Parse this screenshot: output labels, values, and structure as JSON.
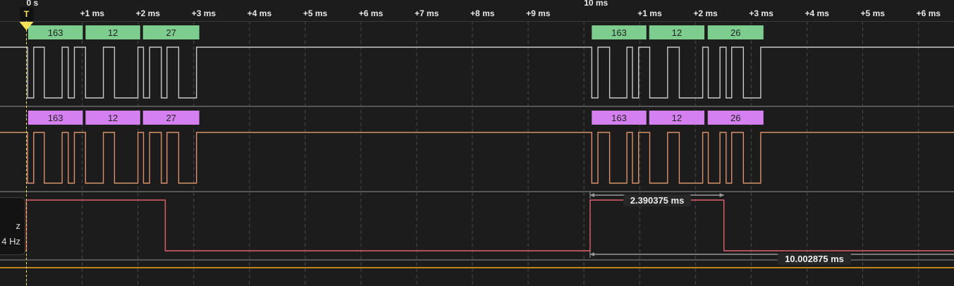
{
  "timeline": {
    "ms_ticks_group1": [
      {
        "ms": 0,
        "label": "0 s"
      },
      {
        "ms": 1,
        "label": "+1 ms"
      },
      {
        "ms": 2,
        "label": "+2 ms"
      },
      {
        "ms": 3,
        "label": "+3 ms"
      },
      {
        "ms": 4,
        "label": "+4 ms"
      },
      {
        "ms": 5,
        "label": "+5 ms"
      },
      {
        "ms": 6,
        "label": "+6 ms"
      },
      {
        "ms": 7,
        "label": "+7 ms"
      },
      {
        "ms": 8,
        "label": "+8 ms"
      },
      {
        "ms": 9,
        "label": "+9 ms"
      }
    ],
    "ms_ticks_group2": [
      {
        "ms": 10,
        "label": "10 ms"
      },
      {
        "ms": 11,
        "label": "+1 ms"
      },
      {
        "ms": 12,
        "label": "+2 ms"
      },
      {
        "ms": 13,
        "label": "+3 ms"
      },
      {
        "ms": 14,
        "label": "+4 ms"
      },
      {
        "ms": 15,
        "label": "+5 ms"
      },
      {
        "ms": 16,
        "label": "+6 ms"
      }
    ],
    "trigger_label": "T",
    "trigger_ms": 0
  },
  "colors": {
    "background": "#1c1c1c",
    "channel0": "#c8c8c8",
    "channel1": "#d9916b",
    "channel2": "#e0606e",
    "channel3": "#f5a623",
    "decode0": "#7ccd8e",
    "decode1": "#d580f0",
    "trigger": "#f7e35a",
    "grid": "#555555"
  },
  "channels": [
    {
      "id": 0,
      "initial": 1,
      "edges_ms": [
        0.02,
        0.13,
        0.32,
        0.64,
        0.75,
        0.86,
        1.06,
        1.38,
        1.58,
        2.0,
        2.1,
        2.21,
        2.42,
        2.52,
        2.73,
        3.05,
        10.14,
        10.25,
        10.46,
        10.77,
        10.87,
        10.98,
        11.18,
        11.5,
        11.71,
        12.13,
        12.23,
        12.44,
        12.55,
        12.65,
        12.86,
        13.17
      ]
    },
    {
      "id": 1,
      "initial": 1,
      "edges_ms": [
        0.02,
        0.13,
        0.32,
        0.64,
        0.75,
        0.86,
        1.06,
        1.38,
        1.58,
        2.0,
        2.1,
        2.21,
        2.42,
        2.52,
        2.73,
        3.05,
        10.14,
        10.25,
        10.46,
        10.77,
        10.87,
        10.98,
        11.18,
        11.5,
        11.71,
        12.13,
        12.23,
        12.44,
        12.55,
        12.65,
        12.86,
        13.17
      ]
    },
    {
      "id": 2,
      "initial": 0,
      "edges_ms": [
        0.0,
        2.49,
        10.11,
        12.51
      ]
    },
    {
      "id": 3,
      "initial": 1,
      "edges_ms": []
    }
  ],
  "decoders": [
    {
      "channel": 0,
      "frames": [
        {
          "start": 0.03,
          "end": 1.01,
          "value": "163"
        },
        {
          "start": 1.06,
          "end": 2.04,
          "value": "12"
        },
        {
          "start": 2.09,
          "end": 3.1,
          "value": "27"
        },
        {
          "start": 10.14,
          "end": 11.12,
          "value": "163"
        },
        {
          "start": 11.17,
          "end": 12.16,
          "value": "12"
        },
        {
          "start": 12.22,
          "end": 13.22,
          "value": "26"
        }
      ]
    },
    {
      "channel": 1,
      "frames": [
        {
          "start": 0.03,
          "end": 1.01,
          "value": "163"
        },
        {
          "start": 1.06,
          "end": 2.04,
          "value": "12"
        },
        {
          "start": 2.09,
          "end": 3.1,
          "value": "27"
        },
        {
          "start": 10.14,
          "end": 11.12,
          "value": "163"
        },
        {
          "start": 11.17,
          "end": 12.16,
          "value": "12"
        },
        {
          "start": 12.22,
          "end": 13.22,
          "value": "26"
        }
      ]
    }
  ],
  "measurements": [
    {
      "label": "2.390375 ms",
      "start_ms": 10.11,
      "end_ms": 12.51
    },
    {
      "label": "10.002875 ms",
      "start_ms": 10.11,
      "end_ms": 17.2
    }
  ],
  "measurement_panel": {
    "line1": "z",
    "line2": "4 Hz"
  }
}
